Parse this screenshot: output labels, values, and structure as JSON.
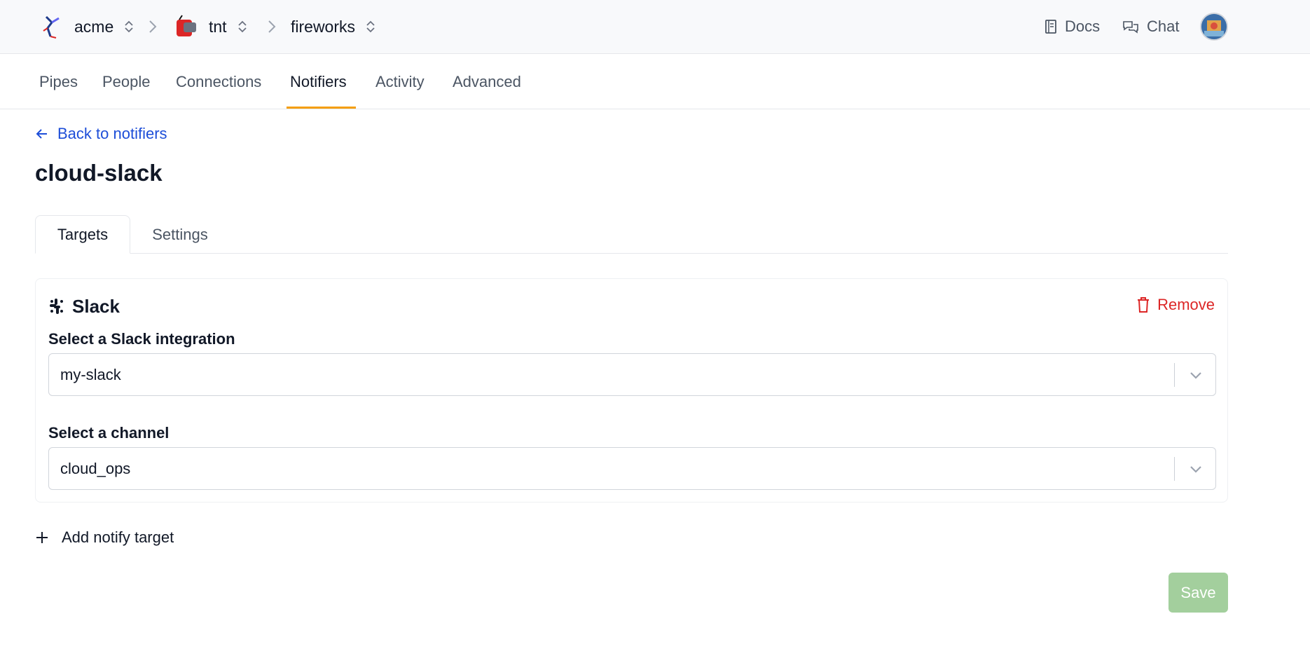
{
  "breadcrumb": {
    "org": "acme",
    "project": "tnt",
    "pipeline": "fireworks"
  },
  "header_links": {
    "docs": "Docs",
    "chat": "Chat"
  },
  "nav": {
    "tabs": [
      {
        "label": "Pipes"
      },
      {
        "label": "People"
      },
      {
        "label": "Connections"
      },
      {
        "label": "Notifiers",
        "active": true
      },
      {
        "label": "Activity"
      },
      {
        "label": "Advanced"
      }
    ]
  },
  "back_link": "Back to notifiers",
  "page_title": "cloud-slack",
  "tabs": [
    {
      "label": "Targets",
      "active": true
    },
    {
      "label": "Settings"
    }
  ],
  "target": {
    "title": "Slack",
    "remove_label": "Remove",
    "integration_label": "Select a Slack integration",
    "integration_value": "my-slack",
    "channel_label": "Select a channel",
    "channel_value": "cloud_ops"
  },
  "add_target_label": "Add notify target",
  "save_label": "Save",
  "colors": {
    "accent_underline": "#f59e0b",
    "link": "#1d4ed8",
    "danger": "#dc2626",
    "save_disabled": "#a3cf9d"
  },
  "icons": [
    "roadrunner-logo-icon",
    "tnt-logo-icon",
    "updown-icon",
    "chevron-right-icon",
    "book-icon",
    "chat-icon",
    "user-avatar",
    "arrow-left-icon",
    "slack-icon",
    "trash-icon",
    "chevron-down-icon",
    "plus-icon"
  ]
}
